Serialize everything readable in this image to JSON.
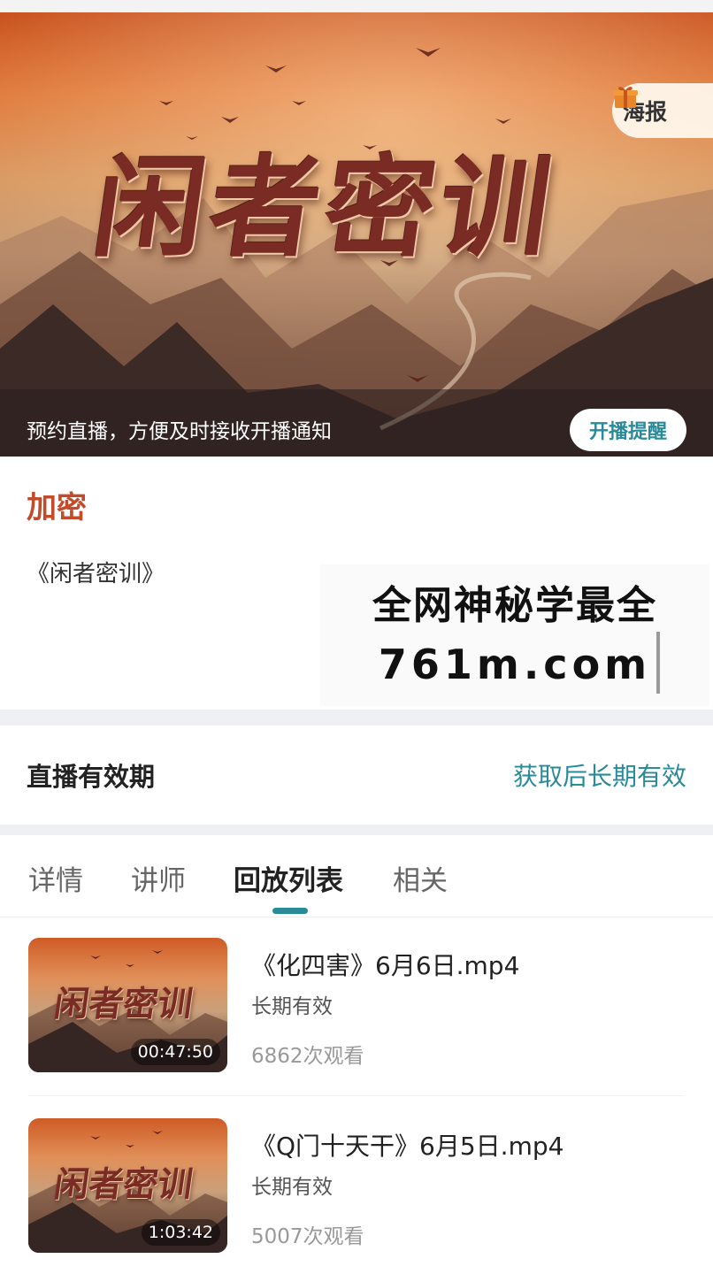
{
  "banner": {
    "title": "闲者密训",
    "poster_label": "海报",
    "notice": "预约直播，方便及时接收开播通知",
    "remind_label": "开播提醒"
  },
  "course": {
    "tag": "加密",
    "name": "《闲者密训》"
  },
  "watermark": {
    "line1": "全网神秘学最全",
    "line2": "761m.com"
  },
  "validity": {
    "label": "直播有效期",
    "value": "获取后长期有效"
  },
  "tabs": [
    {
      "label": "详情"
    },
    {
      "label": "讲师"
    },
    {
      "label": "回放列表"
    },
    {
      "label": "相关"
    }
  ],
  "active_tab": "回放列表",
  "playlist": [
    {
      "thumb_title": "闲者密训",
      "duration": "00:47:50",
      "title": "《化四害》6月6日.mp4",
      "validity": "长期有效",
      "views": "6862次观看"
    },
    {
      "thumb_title": "闲者密训",
      "duration": "1:03:42",
      "title": "《Q门十天干》6月5日.mp4",
      "validity": "长期有效",
      "views": "5007次观看"
    }
  ],
  "colors": {
    "accent": "#2a8b98",
    "tag": "#c14b2a"
  }
}
